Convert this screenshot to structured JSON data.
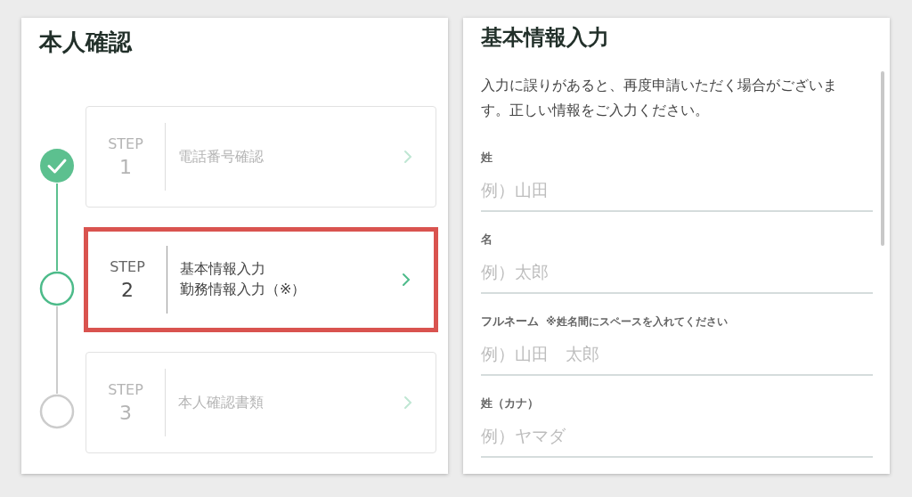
{
  "identity": {
    "title": "本人確認",
    "steps": [
      {
        "label": "STEP",
        "number": "1",
        "lines": [
          "電話番号確認"
        ],
        "kind": "done",
        "highlighted": false
      },
      {
        "label": "STEP",
        "number": "2",
        "lines": [
          "基本情報入力",
          "勤務情報入力（※）"
        ],
        "kind": "current",
        "highlighted": true
      },
      {
        "label": "STEP",
        "number": "3",
        "lines": [
          "本人確認書類"
        ],
        "kind": "pending",
        "highlighted": false
      }
    ]
  },
  "basic_info": {
    "title": "基本情報入力",
    "description": "入力に誤りがあると、再度申請いただく場合がございます。正しい情報をご入力ください。",
    "fields": [
      {
        "label": "姓",
        "placeholder": "例）山田"
      },
      {
        "label": "名",
        "placeholder": "例）太郎"
      },
      {
        "label": "フルネーム",
        "note": "※姓名間にスペースを入れてください",
        "placeholder": "例）山田　太郎"
      },
      {
        "label": "姓（カナ）",
        "placeholder": "例）ヤマダ"
      }
    ]
  }
}
